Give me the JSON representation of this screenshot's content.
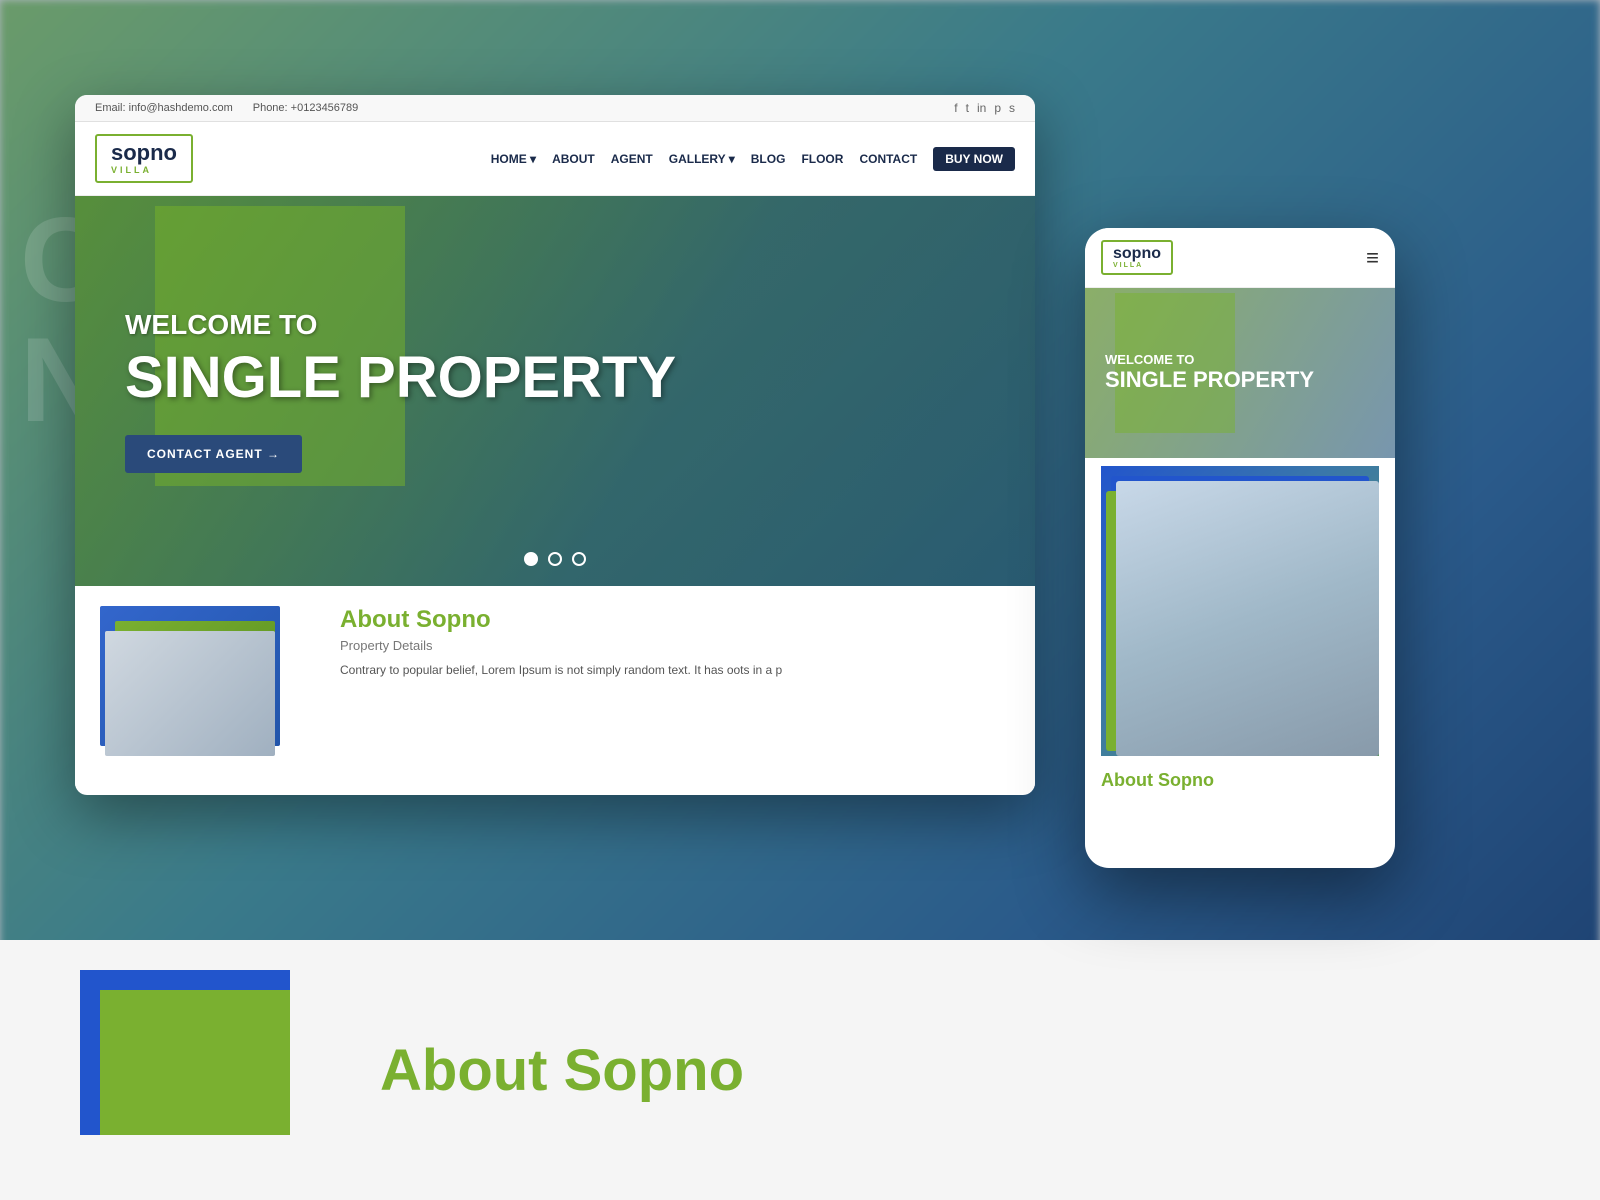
{
  "background": {
    "blur_color": "#6a9b6a"
  },
  "desktop": {
    "topbar": {
      "email_label": "Email:",
      "email": "info@hashdemo.com",
      "phone_label": "Phone:",
      "phone": "+0123456789",
      "social_icons": [
        "f",
        "t",
        "in",
        "p",
        "s"
      ]
    },
    "nav": {
      "logo_main": "sopno",
      "logo_sub": "VILLA",
      "links": [
        "HOME",
        "ABOUT",
        "AGENT",
        "GALLERY",
        "BLOG",
        "FLOOR",
        "CONTACT",
        "BUY NOW"
      ]
    },
    "hero": {
      "welcome": "WELCOME TO",
      "title": "SINGLE PROPERTY",
      "cta": "CONTACT AGENT →",
      "dots": 3
    },
    "about": {
      "title": "About ",
      "title_colored": "Sopno",
      "subtitle": "Property Details",
      "desc": "Contrary to popular belief, Lorem Ipsum is not simply random text. It has oots in a p"
    }
  },
  "mobile": {
    "logo_main": "sopno",
    "logo_sub": "VILLA",
    "hamburger": "≡",
    "hero": {
      "welcome": "WELCOME TO",
      "title": "SINGLE PROPERTY"
    },
    "about_title": "About ",
    "about_title_colored": "Sopno"
  },
  "page_bottom": {
    "title": "About ",
    "title_colored": "Sopno"
  },
  "bg_text": {
    "line1": "C",
    "line2": "N"
  }
}
